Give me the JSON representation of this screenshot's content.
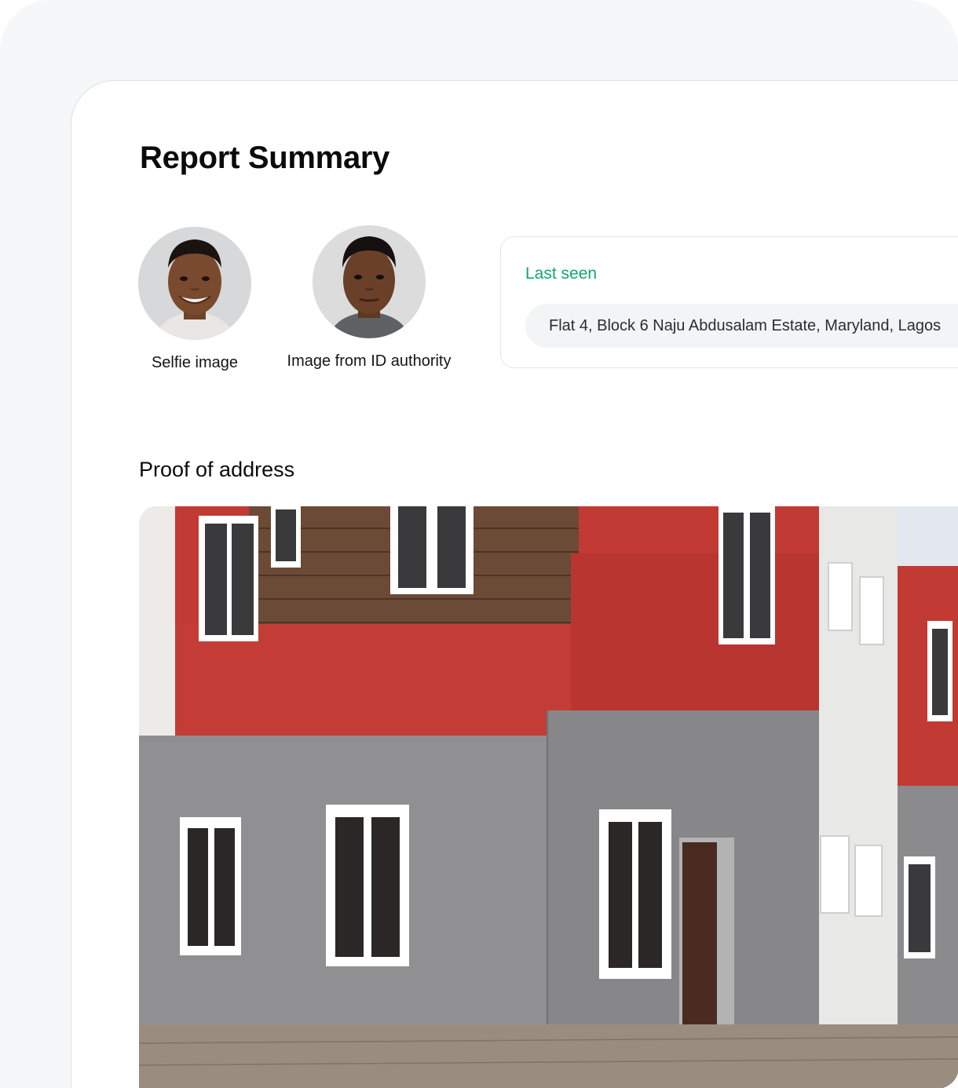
{
  "report": {
    "title": "Report Summary"
  },
  "photos": {
    "selfie_caption": "Selfie image",
    "id_caption": "Image from ID authority"
  },
  "last_seen": {
    "label": "Last seen",
    "address": "Flat 4, Block 6 Naju Abdusalam Estate, Maryland, Lagos"
  },
  "proof_of_address": {
    "title": "Proof of address"
  },
  "colors": {
    "accent_green": "#12a86a",
    "wall_red": "#c23a34",
    "wall_grey": "#8e8e90",
    "wood": "#6b4a36"
  }
}
